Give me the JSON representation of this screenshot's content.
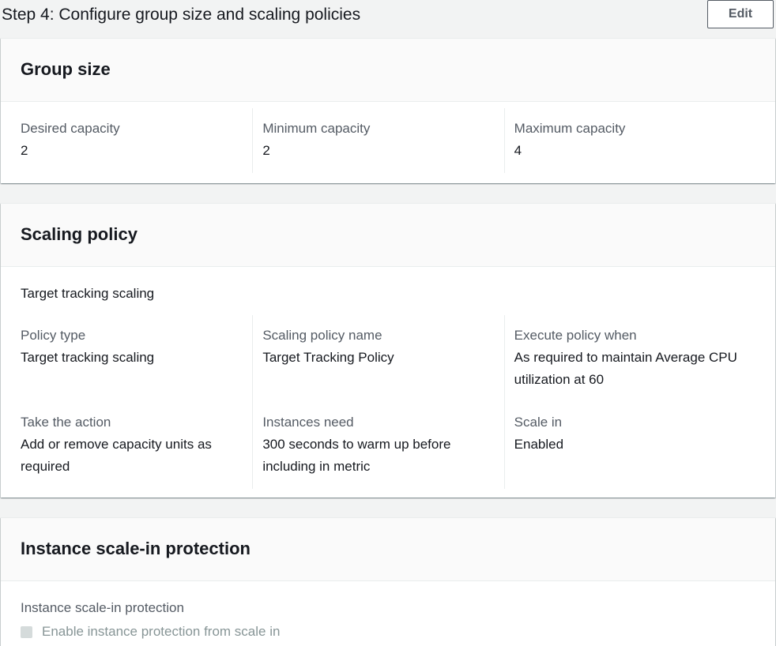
{
  "header": {
    "title": "Step 4: Configure group size and scaling policies",
    "edit_label": "Edit"
  },
  "group_size": {
    "title": "Group size",
    "items": [
      {
        "label": "Desired capacity",
        "value": "2"
      },
      {
        "label": "Minimum capacity",
        "value": "2"
      },
      {
        "label": "Maximum capacity",
        "value": "4"
      }
    ]
  },
  "scaling_policy": {
    "title": "Scaling policy",
    "subheading": "Target tracking scaling",
    "items": [
      {
        "label": "Policy type",
        "value": "Target tracking scaling"
      },
      {
        "label": "Scaling policy name",
        "value": "Target Tracking Policy"
      },
      {
        "label": "Execute policy when",
        "value": "As required to maintain Average CPU utilization at 60"
      },
      {
        "label": "Take the action",
        "value": "Add or remove capacity units as required"
      },
      {
        "label": "Instances need",
        "value": "300 seconds to warm up before including in metric"
      },
      {
        "label": "Scale in",
        "value": "Enabled"
      }
    ]
  },
  "scale_in_protection": {
    "title": "Instance scale-in protection",
    "field_label": "Instance scale-in protection",
    "checkbox_label": "Enable instance protection from scale in",
    "checked": false
  }
}
